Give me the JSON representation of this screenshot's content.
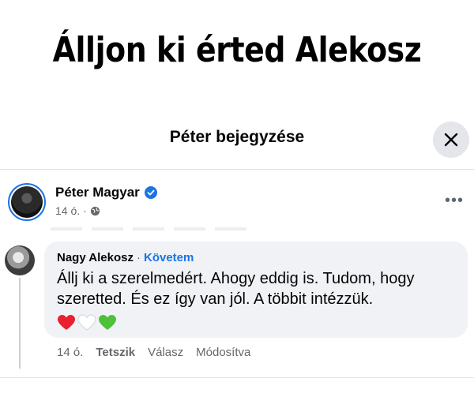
{
  "headline": "Álljon ki érted Alekosz",
  "dialog": {
    "title": "Péter bejegyzése",
    "close_icon": "close-icon"
  },
  "post": {
    "author": "Péter Magyar",
    "verified_icon": "verified-badge-icon",
    "time": "14 ó.",
    "separator": "·",
    "audience_icon": "globe-icon",
    "more_label": "•••"
  },
  "comment": {
    "author": "Nagy Alekosz",
    "separator": "·",
    "follow_label": "Követem",
    "text": "Állj ki a szerelmedért. Ahogy eddig is. Tudom, hogy szeretted. És ez így van jól. A többit intézzük.",
    "emojis": [
      "red-heart-icon",
      "white-heart-icon",
      "green-heart-icon"
    ],
    "time": "14 ó.",
    "like_label": "Tetszik",
    "reply_label": "Válasz",
    "edited_label": "Módosítva"
  },
  "colors": {
    "accent": "#1b74e4",
    "bubble_bg": "#f0f2f5",
    "secondary_text": "#65676b",
    "close_bg": "#e4e6eb"
  }
}
